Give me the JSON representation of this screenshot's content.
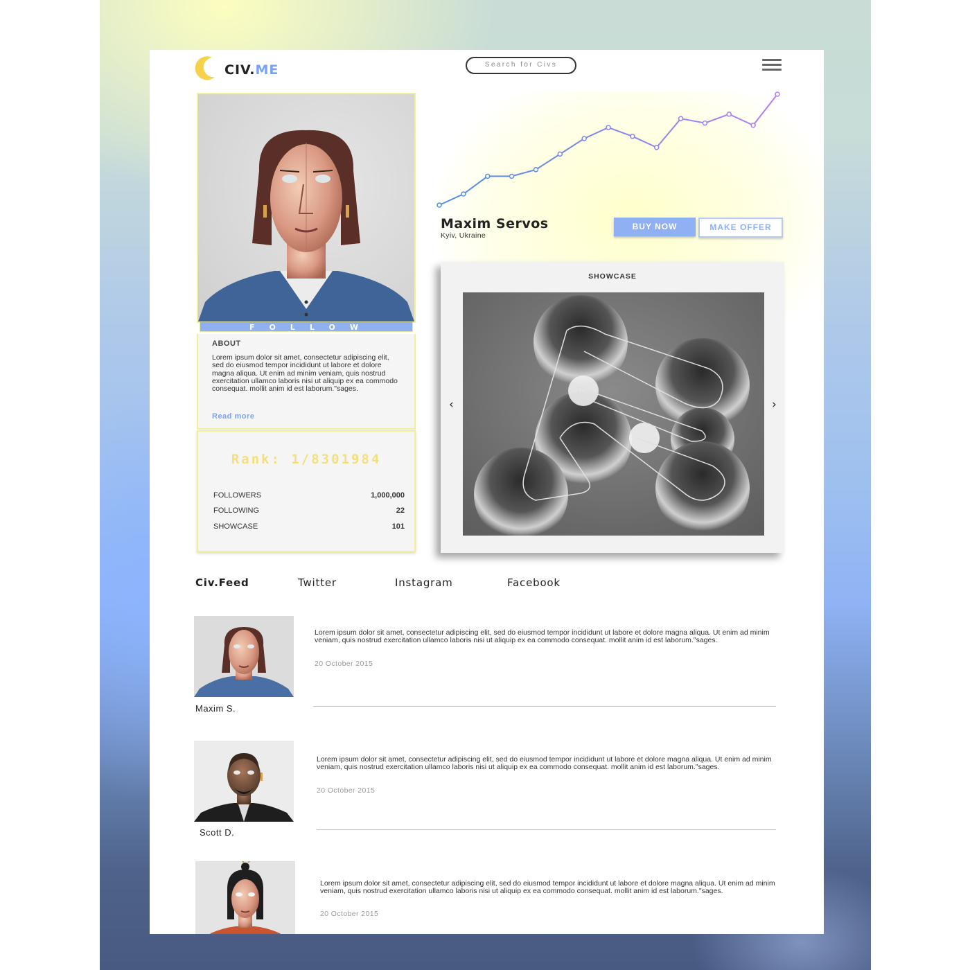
{
  "brand": {
    "name_main": "CIV.",
    "name_accent": "ME",
    "accent_color": "#7aa2f2",
    "mark_color": "#f6d24a"
  },
  "search": {
    "placeholder": "Search for Civs"
  },
  "profile": {
    "follow_label": "FOLLOW",
    "name": "Maxim Servos",
    "location": "Kyiv, Ukraine",
    "buy_label": "BUY NOW",
    "offer_label": "MAKE OFFER"
  },
  "about": {
    "title": "ABOUT",
    "text": "Lorem ipsum dolor sit amet, consectetur adipiscing elit, sed do eiusmod tempor incididunt ut labore et dolore magna aliqua. Ut enim ad minim veniam, quis nostrud exercitation ullamco laboris nisi ut aliquip ex ea commodo consequat.  mollit anim id est laborum.\"sages.",
    "read_more": "Read more"
  },
  "stats": {
    "rank": "Rank: 1/8301984",
    "rows": [
      {
        "label": "FOLLOWERS",
        "value": "1,000,000"
      },
      {
        "label": "FOLLOWING",
        "value": "22"
      },
      {
        "label": "SHOWCASE",
        "value": "101"
      }
    ]
  },
  "chart_data": {
    "type": "line",
    "values": [
      0,
      5,
      13,
      13,
      16,
      23,
      30,
      35,
      31,
      26,
      39,
      37,
      41,
      36,
      50
    ],
    "ylim": [
      0,
      50
    ],
    "gradient": [
      "#4a90e2",
      "#b77ef0"
    ]
  },
  "showcase": {
    "title": "SHOWCASE",
    "prev": "‹",
    "next": "›"
  },
  "tabs": [
    "Civ.Feed",
    "Twitter",
    "Instagram",
    "Facebook"
  ],
  "feed": [
    {
      "name": "Maxim S.",
      "text": "Lorem ipsum dolor sit amet, consectetur adipiscing elit, sed do eiusmod tempor incididunt ut labore et dolore magna aliqua. Ut enim ad minim veniam, quis nostrud exercitation ullamco laboris nisi ut aliquip ex ea commodo consequat.  mollit anim id est laborum.\"sages.",
      "date": "20 October 2015"
    },
    {
      "name": "Scott D.",
      "text": "Lorem ipsum dolor sit amet, consectetur adipiscing elit, sed do eiusmod tempor incididunt ut labore et dolore magna aliqua. Ut enim ad minim veniam, quis nostrud exercitation ullamco laboris nisi ut aliquip ex ea commodo consequat.  mollit anim id est laborum.\"sages.",
      "date": "20 October 2015"
    },
    {
      "text": "Lorem ipsum dolor sit amet, consectetur adipiscing elit, sed do eiusmod tempor incididunt ut labore et dolore magna aliqua. Ut enim ad minim veniam, quis nostrud exercitation ullamco laboris nisi ut aliquip ex ea commodo consequat.  mollit anim id est laborum.\"sages.",
      "date": "20 October 2015"
    }
  ]
}
